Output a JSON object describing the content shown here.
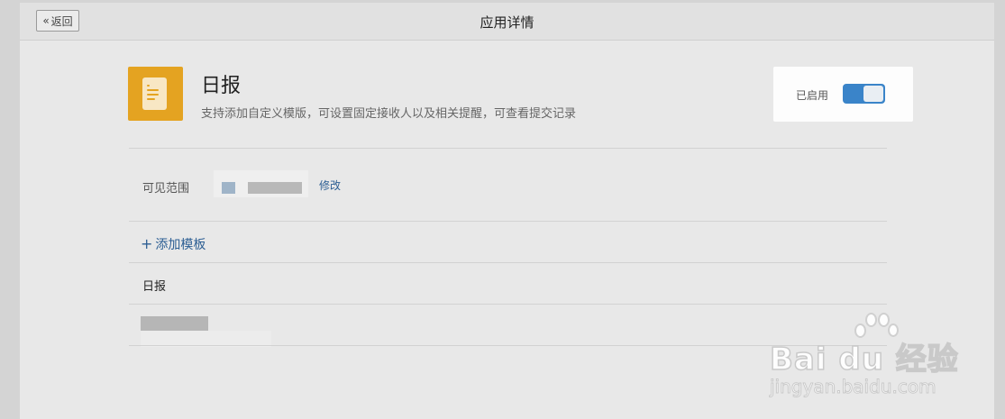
{
  "header": {
    "back_label": "返回",
    "back_icon": "double-chevron-left-icon",
    "title": "应用详情"
  },
  "app": {
    "icon": "document-icon",
    "icon_color": "#e4a321",
    "name": "日报",
    "description": "支持添加自定义模版，可设置固定接收人以及相关提醒，可查看提交记录"
  },
  "status": {
    "label": "已启用",
    "enabled": true,
    "toggle_color": "#3a84c9"
  },
  "visibility": {
    "label": "可见范围",
    "edit_label": "修改"
  },
  "templates": {
    "add_label": "添加模板",
    "add_icon": "plus-icon",
    "items": [
      {
        "label": "日报"
      }
    ]
  },
  "watermark": {
    "brand": "Bai du 经验",
    "url": "jingyan.baidu.com"
  }
}
